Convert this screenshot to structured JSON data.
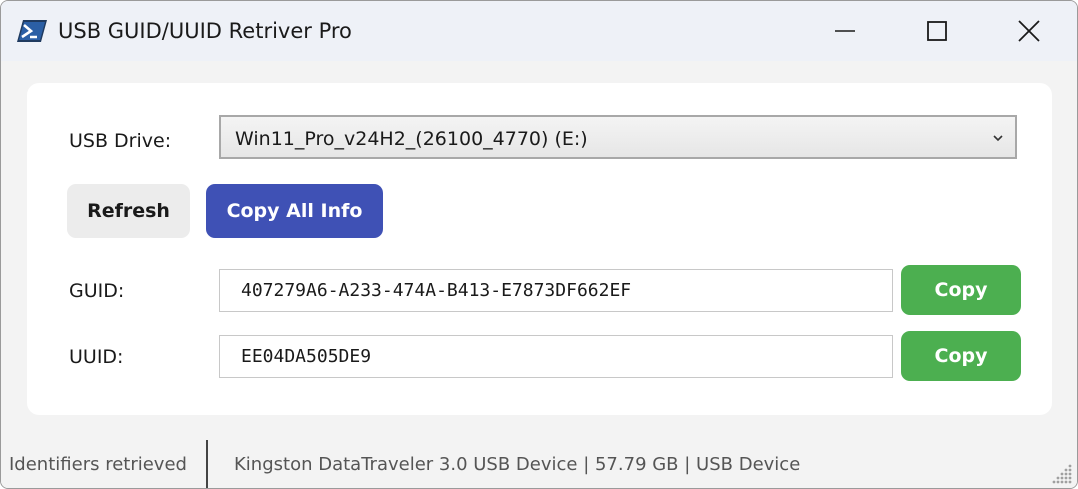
{
  "window": {
    "title": "USB GUID/UUID Retriver Pro",
    "icon": "powershell-icon",
    "controls": [
      "minimize-icon",
      "maximize-icon",
      "close-icon"
    ]
  },
  "drive": {
    "label": "USB Drive:",
    "selected": "Win11_Pro_v24H2_(26100_4770) (E:)"
  },
  "actions": {
    "refresh_label": "Refresh",
    "copy_all_label": "Copy All Info"
  },
  "guid": {
    "label": "GUID:",
    "value": "407279A6-A233-474A-B413-E7873DF662EF",
    "copy_label": "Copy"
  },
  "uuid": {
    "label": "UUID:",
    "value": "EE04DA505DE9",
    "copy_label": "Copy"
  },
  "status": {
    "left": "Identifiers retrieved",
    "right": "Kingston DataTraveler 3.0 USB Device | 57.79 GB | USB Device"
  },
  "colors": {
    "accent_blue": "#3f51b5",
    "copy_green": "#4caf50",
    "titlebar": "#eef1f7"
  }
}
